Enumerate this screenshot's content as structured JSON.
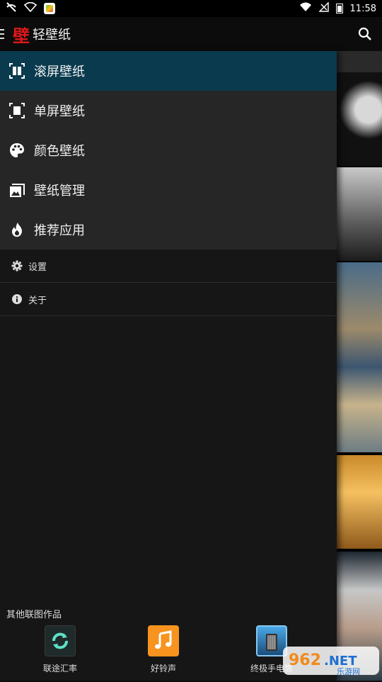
{
  "status_bar": {
    "time": "11:58"
  },
  "app_bar": {
    "logo_char": "壁",
    "title": "轻壁纸"
  },
  "drawer": {
    "items": [
      {
        "label": "滚屏壁纸",
        "icon": "scroll-wallpaper-icon",
        "active": true
      },
      {
        "label": "单屏壁纸",
        "icon": "single-wallpaper-icon",
        "active": false
      },
      {
        "label": "颜色壁纸",
        "icon": "palette-icon",
        "active": false
      },
      {
        "label": "壁纸管理",
        "icon": "image-icon",
        "active": false
      },
      {
        "label": "推荐应用",
        "icon": "flame-icon",
        "active": false
      }
    ],
    "secondary": [
      {
        "label": "设置",
        "icon": "gear-icon"
      },
      {
        "label": "关于",
        "icon": "info-icon"
      }
    ],
    "other_title": "其他联图作品",
    "apps": [
      {
        "label": "联途汇率",
        "icon": "refresh-rate-icon"
      },
      {
        "label": "好铃声",
        "icon": "music-note-icon"
      },
      {
        "label": "终极手电筒",
        "icon": "flashlight-icon"
      }
    ]
  },
  "colors": {
    "active_bg": "#0a3a4e",
    "logo": "#e01818",
    "ring_app": "#f7931e"
  },
  "watermark": {
    "line1": "962.NET",
    "line2": "乐游网"
  }
}
